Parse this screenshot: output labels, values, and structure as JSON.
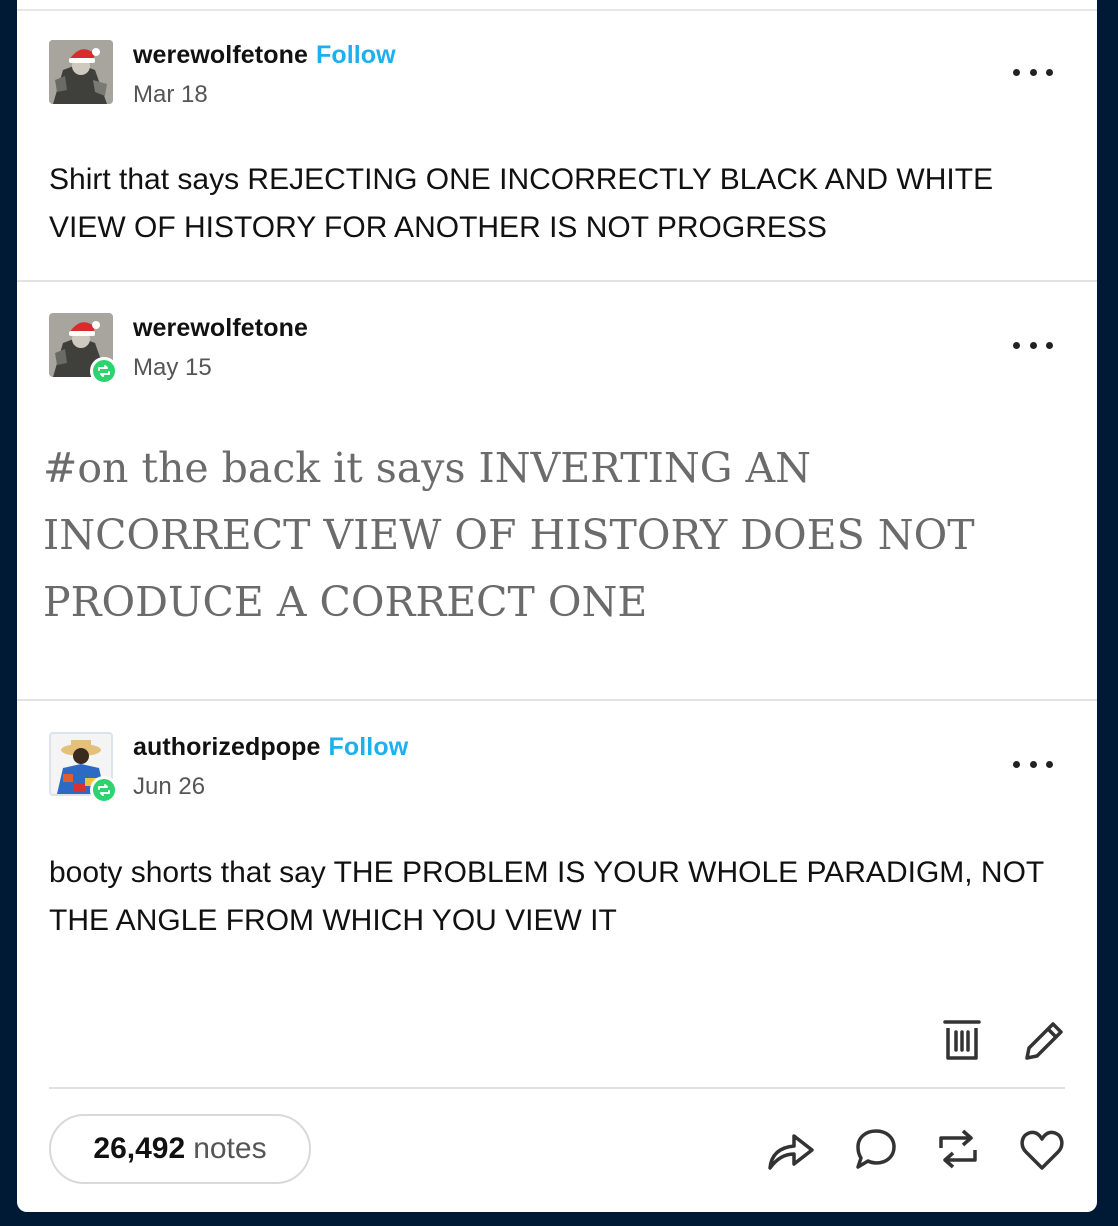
{
  "posts": [
    {
      "username": "werewolfetone",
      "follow_label": "Follow",
      "date": "Mar 18",
      "text": "Shirt that says REJECTING ONE INCORRECTLY BLACK AND WHITE VIEW OF HISTORY FOR ANOTHER IS NOT PROGRESS"
    },
    {
      "username": "werewolfetone",
      "date": "May 15",
      "text": "#on the back it says INVERTING AN INCORRECT VIEW OF HISTORY DOES NOT PRODUCE A CORRECT ONE"
    },
    {
      "username": "authorizedpope",
      "follow_label": "Follow",
      "date": "Jun 26",
      "text": "booty shorts that say THE PROBLEM IS YOUR WHOLE PARADIGM, NOT THE ANGLE FROM WHICH YOU VIEW IT"
    }
  ],
  "footer": {
    "notes_count": "26,492",
    "notes_label": "notes"
  },
  "icons": {
    "more": "ellipsis-icon",
    "delete": "trash-icon",
    "edit": "pencil-icon",
    "share": "share-icon",
    "reply": "comment-icon",
    "reblog": "reblog-icon",
    "like": "heart-icon",
    "reblog_badge": "reblog-badge-icon"
  },
  "colors": {
    "background": "#001935",
    "follow": "#1db0f0",
    "reblog_badge": "#2bd46f"
  }
}
